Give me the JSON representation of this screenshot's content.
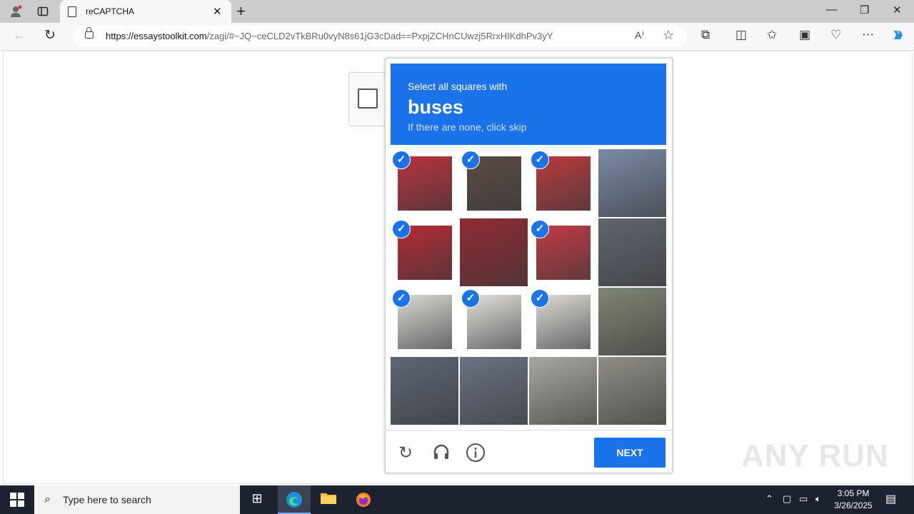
{
  "browser": {
    "tab_title": "reCAPTCHA",
    "url_domain": "https://essaystoolkit.com",
    "url_path": "/zagi/#~JQ~ceCLD2vTkBRu0vyN8s61jG3cDad==PxpjZCHnCUwzj5RrxHIKdhPv3yY"
  },
  "captcha": {
    "instruction": "Select all squares with",
    "target": "buses",
    "hint": "If there are none, click skip",
    "next_label": "NEXT",
    "tiles": [
      {
        "selected": true,
        "color": "#b8323c"
      },
      {
        "selected": true,
        "color": "#5a4a44"
      },
      {
        "selected": true,
        "color": "#b83a3e"
      },
      {
        "selected": false,
        "color": "#7b8aa6"
      },
      {
        "selected": true,
        "color": "#b52a35"
      },
      {
        "selected": false,
        "color": "#8e2a33"
      },
      {
        "selected": true,
        "color": "#c23a44"
      },
      {
        "selected": false,
        "color": "#5f6570"
      },
      {
        "selected": true,
        "color": "#d8d8d4"
      },
      {
        "selected": true,
        "color": "#e2e0dc"
      },
      {
        "selected": true,
        "color": "#dcdad6"
      },
      {
        "selected": false,
        "color": "#7f8574"
      },
      {
        "selected": false,
        "color": "#5d6675"
      },
      {
        "selected": false,
        "color": "#6a7282"
      },
      {
        "selected": false,
        "color": "#a9a7a0"
      },
      {
        "selected": false,
        "color": "#8f8d85"
      }
    ]
  },
  "watermark": "ANY RUN",
  "taskbar": {
    "search_placeholder": "Type here to search",
    "time": "3:05 PM",
    "date": "3/26/2025"
  }
}
